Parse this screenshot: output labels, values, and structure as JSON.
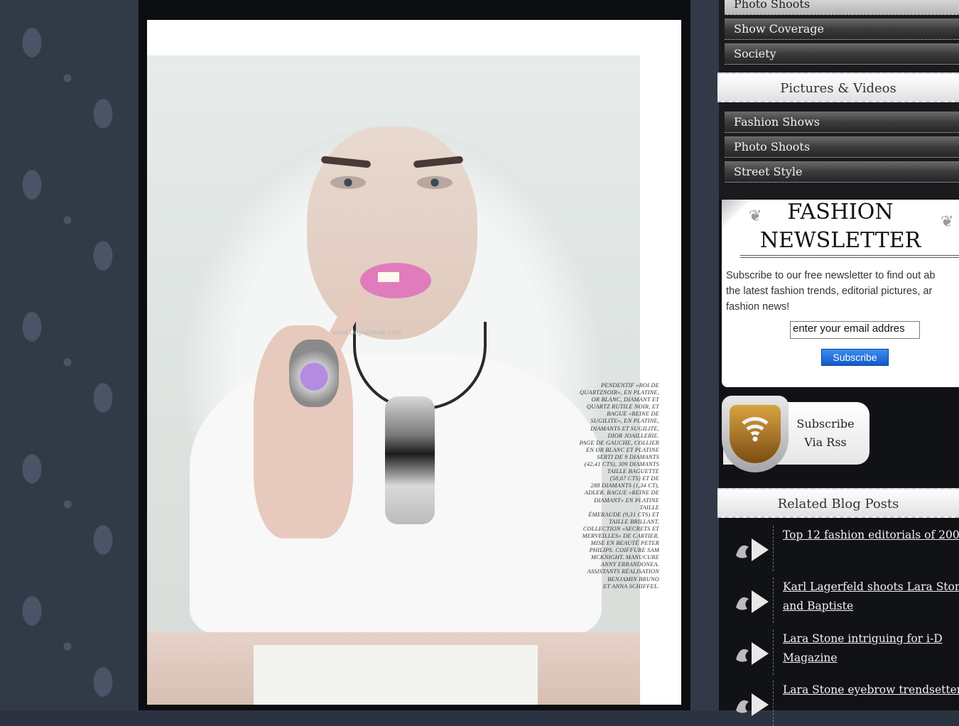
{
  "sidebar": {
    "top_nav": [
      {
        "label": "Photo Shoots",
        "active": true
      },
      {
        "label": "Show Coverage",
        "active": false
      },
      {
        "label": "Society",
        "active": false
      }
    ],
    "pictures_videos": {
      "title": "Pictures & Videos",
      "items": [
        "Fashion Shows",
        "Photo Shoots",
        "Street Style"
      ]
    },
    "newsletter": {
      "title_line1": "FASHION",
      "title_line2": "NEWSLETTER",
      "text_line1": "Subscribe to our free newsletter to find out ab",
      "text_line2": "the latest fashion trends, editorial pictures, ar",
      "text_line3": "fashion news!",
      "email_value": "enter your email addres",
      "button_label": "Subscribe"
    },
    "rss": {
      "line1": "Subscribe",
      "line2": "Via Rss"
    },
    "related": {
      "title": "Related Blog Posts",
      "posts": [
        {
          "line1": "Top 12 fashion editorials of 200",
          "line2": ""
        },
        {
          "line1": "Karl Lagerfeld shoots Lara Stone",
          "line2": "and Baptiste"
        },
        {
          "line1": "Lara Stone intriguing for i-D",
          "line2": "Magazine"
        },
        {
          "line1": "Lara Stone eyebrow trendsetter",
          "line2": ""
        }
      ]
    }
  },
  "photo": {
    "watermark": "www.DaysEbook.com",
    "credits": "PENDENTIF «ROI DE\nQUARTZNOIR», EN PLATINE,\nOR BLANC, DIAMANT ET\nQUARTZ RUTILE NOIR, ET\nBAGUE «REINE DE\nSUGILITE», EN PLATINE,\nDIAMANTS ET SUGILITE,\nDIOR JOAILLERIE.\nPAGE DE GAUCHE, COLLIER\nEN OR BLANC ET PLATINE\nSERTI DE 9 DIAMANTS\n(42,41 CTS), 309 DIAMANTS\nTAILLE BAGUETTE\n(58,67 CTS) ET DE\n288 DIAMANTS (1,34 CT),\nADLER. BAGUE «REINE DE\nDIAMANT» EN PLATINE TAILLE\nÉMERAUDE (9,31 CTS) ET\nTAILLE BRILLANT,\nCOLLECTION «SECRETS ET\nMERVEILLES» DE CARTIER.\nMISE EN BEAUTÉ PETER\nPHILIPS. COIFFURE SAM\nMCKNIGHT. MANUCURE\nANNY ERRANDONEA.\nASSISTANTS RÉALISATION\nBENJAMIN BRUNO\nET ANNA SCHIFFEL."
  },
  "colors": {
    "page_bg": "#2c3340",
    "sidebar_bg": "#111216",
    "nav_active": "#c9c9c9",
    "subscribe_button": "#1e6fdc"
  }
}
